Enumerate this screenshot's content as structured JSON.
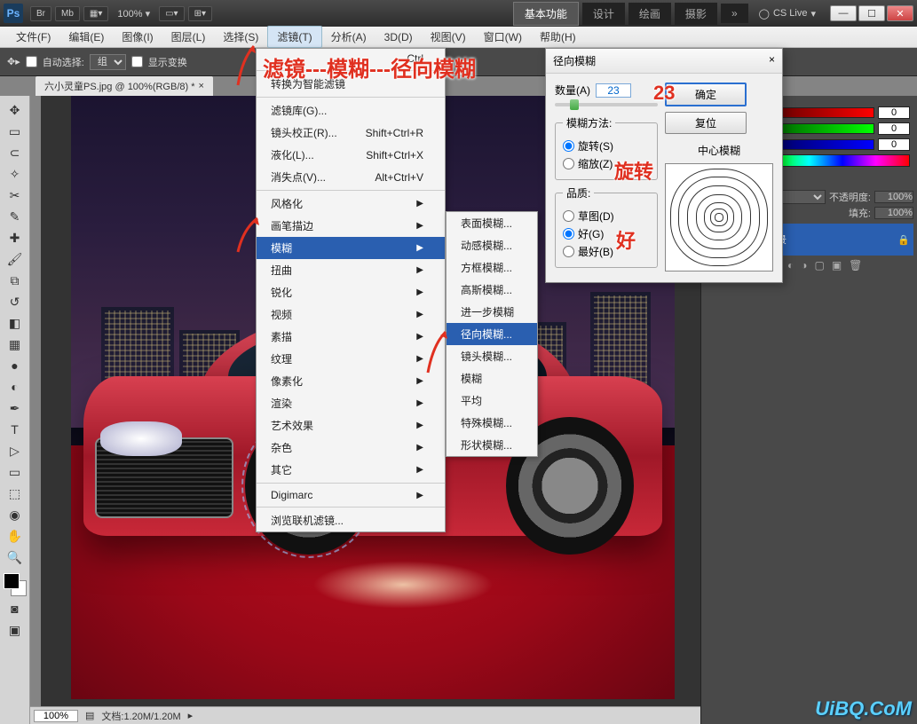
{
  "titlebar": {
    "logo": "Ps",
    "btns": [
      "Br",
      "Mb"
    ],
    "zoom": "100%",
    "modes": [
      "基本功能",
      "设计",
      "绘画",
      "摄影"
    ],
    "cslive": "CS Live"
  },
  "menubar": {
    "items": [
      "文件(F)",
      "编辑(E)",
      "图像(I)",
      "图层(L)",
      "选择(S)",
      "滤镜(T)",
      "分析(A)",
      "3D(D)",
      "视图(V)",
      "窗口(W)",
      "帮助(H)"
    ]
  },
  "optbar": {
    "autoselect": "自动选择:",
    "group": "组",
    "showtransform": "显示变换"
  },
  "doctab": {
    "name": "六小灵童PS.jpg @ 100%(RGB/8) *",
    "close": "×"
  },
  "status": {
    "zoom": "100%",
    "docinfo": "文档:1.20M/1.20M"
  },
  "rgb": {
    "r": "0",
    "g": "0",
    "b": "0"
  },
  "layers": {
    "opacity_label": "不透明度:",
    "opacity": "100%",
    "fill_label": "填充:",
    "fill": "100%",
    "bg": "背景"
  },
  "filtermenu": {
    "last": "转换为智能滤镜",
    "shortcut_ctrl": "Ctrl",
    "gallery": "滤镜库(G)...",
    "lens": "镜头校正(R)...",
    "lens_sc": "Shift+Ctrl+R",
    "liquify": "液化(L)...",
    "liquify_sc": "Shift+Ctrl+X",
    "vanish": "消失点(V)...",
    "vanish_sc": "Alt+Ctrl+V",
    "stylize": "风格化",
    "brush": "画笔描边",
    "blur": "模糊",
    "distort": "扭曲",
    "sharpen": "锐化",
    "video": "视频",
    "sketch": "素描",
    "texture": "纹理",
    "pixelate": "像素化",
    "render": "渲染",
    "artistic": "艺术效果",
    "noise": "杂色",
    "other": "其它",
    "digimarc": "Digimarc",
    "browse": "浏览联机滤镜..."
  },
  "blurmenu": {
    "surface": "表面模糊...",
    "motion": "动感模糊...",
    "box": "方框模糊...",
    "gaussian": "高斯模糊...",
    "further": "进一步模糊",
    "radial": "径向模糊...",
    "lens": "镜头模糊...",
    "blur": "模糊",
    "average": "平均",
    "special": "特殊模糊...",
    "shape": "形状模糊..."
  },
  "dialog": {
    "title": "径向模糊",
    "close": "×",
    "amount_label": "数量(A)",
    "amount_value": "23",
    "ok": "确定",
    "cancel": "复位",
    "method_legend": "模糊方法:",
    "spin": "旋转(S)",
    "zoom": "缩放(Z)",
    "quality_legend": "品质:",
    "draft": "草图(D)",
    "good": "好(G)",
    "best": "最好(B)",
    "center_label": "中心模糊"
  },
  "anno": {
    "path": "滤镜---模糊---径向模糊",
    "amount": "23",
    "spin": "旋转",
    "good": "好"
  },
  "watermark": "UiBQ.CoM"
}
